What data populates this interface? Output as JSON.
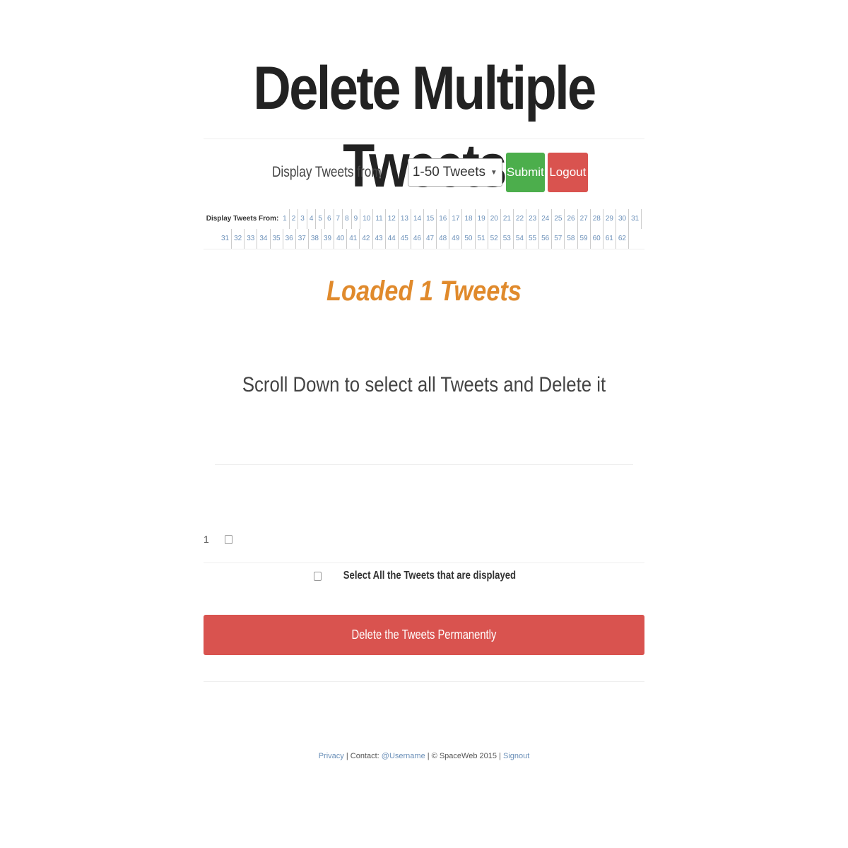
{
  "page": {
    "title": "Delete Multiple Tweets"
  },
  "controls": {
    "display_label": "Display Tweets from",
    "range_selected": "1-50 Tweets",
    "submit_label": "Submit",
    "logout_label": "Logout"
  },
  "pager": {
    "title": "Display Tweets From:",
    "pages_row1": [
      "1",
      "2",
      "3",
      "4",
      "5",
      "6",
      "7",
      "8",
      "9",
      "10",
      "11",
      "12",
      "13",
      "14",
      "15",
      "16",
      "17",
      "18",
      "19",
      "20",
      "21",
      "22",
      "23",
      "24",
      "25",
      "26",
      "27",
      "28",
      "29",
      "30",
      "31"
    ],
    "pages_row2": [
      "31",
      "32",
      "33",
      "34",
      "35",
      "36",
      "37",
      "38",
      "39",
      "40",
      "41",
      "42",
      "43",
      "44",
      "45",
      "46",
      "47",
      "48",
      "49",
      "50",
      "51",
      "52",
      "53",
      "54",
      "55",
      "56",
      "57",
      "58",
      "59",
      "60",
      "61",
      "62"
    ]
  },
  "status": {
    "loaded_text": "Loaded 1 Tweets",
    "scroll_note": "Scroll Down to select all Tweets and Delete it"
  },
  "tweets": [
    {
      "number": "1"
    }
  ],
  "select_all": {
    "label": "Select All the Tweets that are displayed"
  },
  "delete_button": {
    "label": "Delete the Tweets Permanently"
  },
  "footer": {
    "privacy": "Privacy",
    "sep1": " | Contact: ",
    "contact": "@Username",
    "sep2": " | © SpaceWeb 2015 | ",
    "signout": "Signout"
  },
  "colors": {
    "submit": "#4cae4c",
    "danger": "#d9534f",
    "loaded": "#e08a2c",
    "link": "#6a8fb8"
  }
}
